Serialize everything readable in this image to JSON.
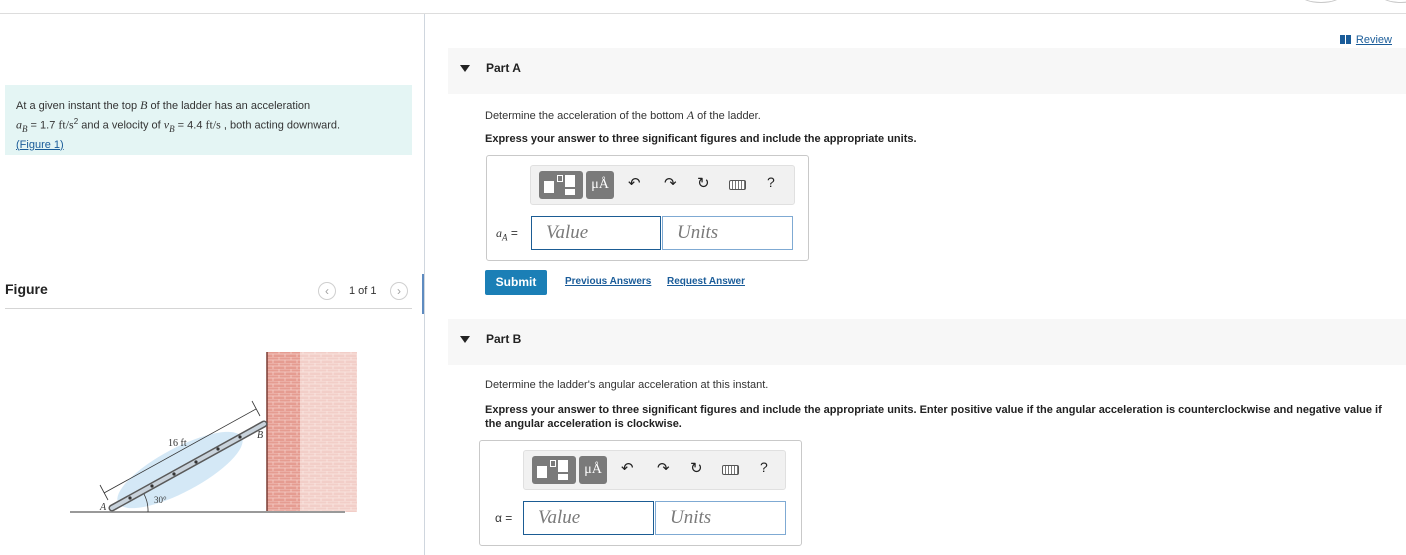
{
  "problem": {
    "intro": "At a given instant the top ",
    "point_top": "B",
    "after_top": " of the ladder has an acceleration",
    "accel_var": "a",
    "accel_sub": "B",
    "accel_eq": " = 1.7 ",
    "accel_unit": "ft/s",
    "accel_exp": "2",
    "mid": " and a velocity of ",
    "vel_var": "v",
    "vel_sub": "B",
    "vel_eq": " = 4.4 ",
    "vel_unit": "ft/s",
    "tail": " , both acting downward.",
    "figure_link_open": "(",
    "figure_link": "Figure 1",
    "figure_link_close": ")"
  },
  "figure_panel": {
    "title": "Figure",
    "prev_icon": "chevron-left-icon",
    "next_icon": "chevron-right-icon",
    "page_count": "1 of 1",
    "labels": {
      "length": "16 ft",
      "angle": "30°",
      "point_a": "A",
      "point_b": "B"
    }
  },
  "review": {
    "icon": "book-icon",
    "label": "Review"
  },
  "partA": {
    "title": "Part A",
    "question_pre": "Determine the acceleration of the bottom ",
    "question_var": "A",
    "question_post": " of the ladder.",
    "instruction": "Express your answer to three significant figures and include the appropriate units.",
    "toolbar": {
      "templates_icon": "templates-icon",
      "units_label": "μÅ",
      "undo_icon": "undo-icon",
      "redo_icon": "redo-icon",
      "reset_icon": "reset-icon",
      "keyboard_icon": "keyboard-icon",
      "help_label": "?"
    },
    "answer_var": "a",
    "answer_sub": "A",
    "answer_eq": " =",
    "value_placeholder": "Value",
    "units_placeholder": "Units",
    "submit": "Submit",
    "previous_answers": "Previous Answers",
    "request_answer": "Request Answer"
  },
  "partB": {
    "title": "Part B",
    "question": "Determine the ladder's angular acceleration at this instant.",
    "instruction": "Express your answer to three significant figures and include the appropriate units. Enter positive value if the angular acceleration is counterclockwise and negative value if the angular acceleration is clockwise.",
    "toolbar": {
      "templates_icon": "templates-icon",
      "units_label": "μÅ",
      "undo_icon": "undo-icon",
      "redo_icon": "redo-icon",
      "reset_icon": "reset-icon",
      "keyboard_icon": "keyboard-icon",
      "help_label": "?"
    },
    "answer_var": "α",
    "answer_eq": " =",
    "value_placeholder": "Value",
    "units_placeholder": "Units"
  },
  "colors": {
    "problem_bg": "#e4f5f4",
    "link": "#1a5c99",
    "submit_bg": "#1b7fb6",
    "brick": "#d9786c"
  }
}
